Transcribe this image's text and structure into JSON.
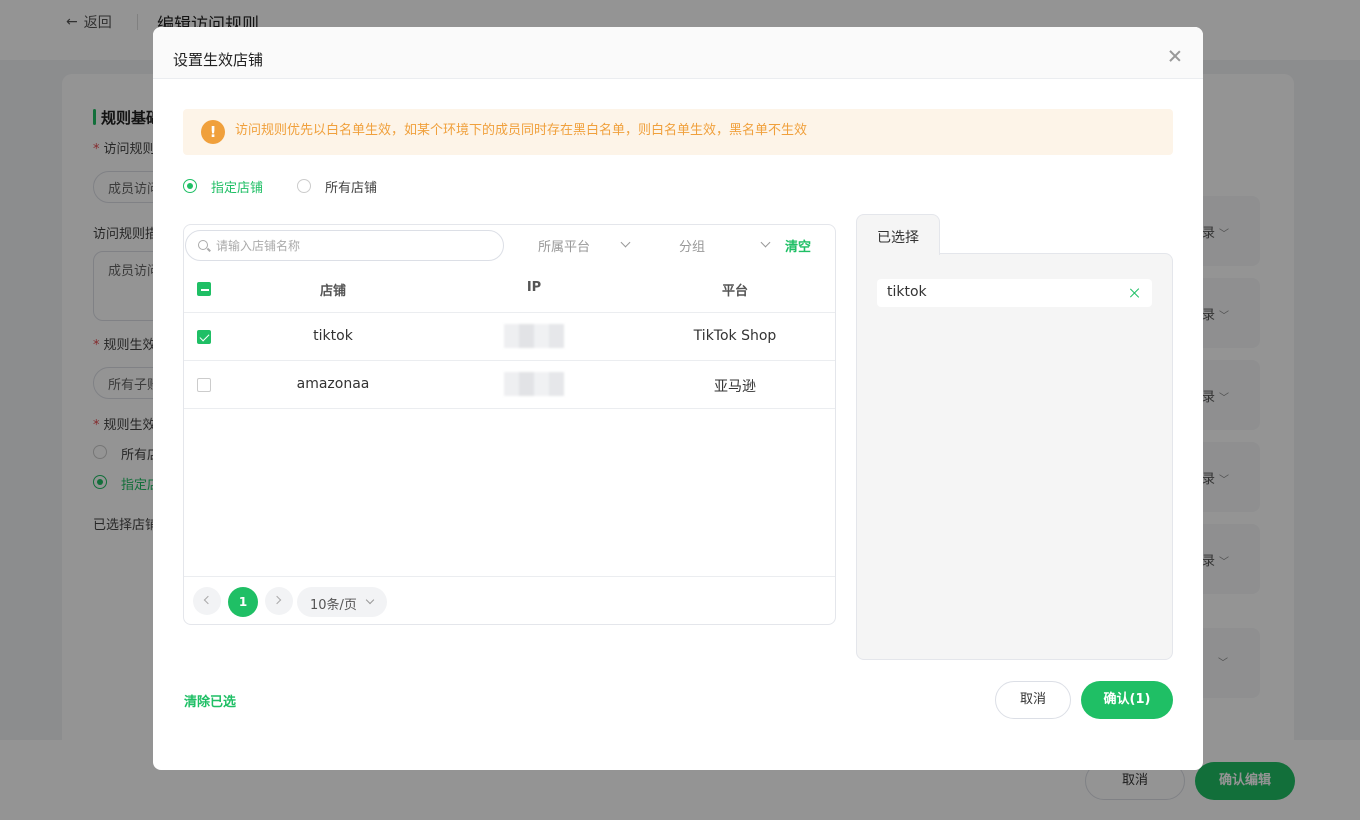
{
  "background": {
    "back_label": "返回",
    "page_title": "编辑访问规则",
    "section_title": "规则基础",
    "label_rule_name": "访问规则",
    "input_member_access": "成员访问",
    "label_rule_desc": "访问规则描",
    "textarea_value": "成员访问",
    "label_scope": "规则生效",
    "input_scope": "所有子账",
    "label_stores": "规则生效",
    "radio_all": "所有店",
    "radio_specified": "指定店",
    "selected_stores_label": "已选择店铺",
    "right_boxes": [
      "录",
      "录",
      "录",
      "录",
      "录",
      ""
    ],
    "footer_cancel": "取消",
    "footer_confirm": "确认编辑"
  },
  "modal": {
    "title": "设置生效店铺",
    "alert_text": "访问规则优先以白名单生效，如某个环境下的成员同时存在黑白名单，则白名单生效，黑名单不生效",
    "radio_specified": "指定店铺",
    "radio_all": "所有店铺",
    "search_placeholder": "请输入店铺名称",
    "filter_platform": "所属平台",
    "filter_group": "分组",
    "clear_label": "清空",
    "table": {
      "headers": {
        "store": "店铺",
        "ip": "IP",
        "platform": "平台"
      },
      "rows": [
        {
          "store": "tiktok",
          "platform": "TikTok Shop",
          "checked": true
        },
        {
          "store": "amazonaa",
          "platform": "亚马逊",
          "checked": false
        }
      ]
    },
    "pagination": {
      "current_page": "1",
      "page_size": "10条/页"
    },
    "selected_tab": "已选择",
    "selected_items": [
      "tiktok"
    ],
    "clear_selected": "清除已选",
    "cancel_label": "取消",
    "confirm_label": "确认(1)"
  },
  "colors": {
    "accent": "#1fbf65",
    "warning": "#f0a03c",
    "warning_bg": "#fdf4e8"
  }
}
